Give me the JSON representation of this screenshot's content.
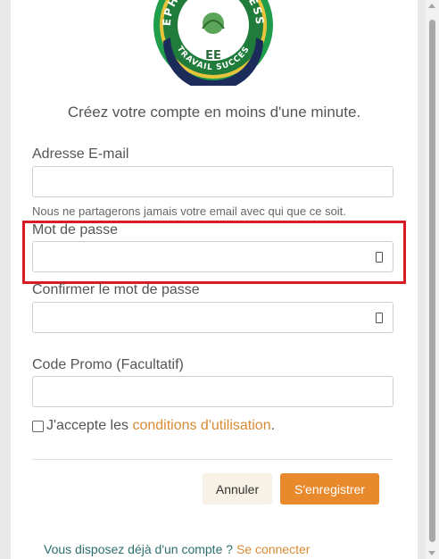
{
  "logo": {
    "arc_top": "EPHATA BUSINESS",
    "initials": "EE",
    "arc_bottom": "TRAVAIL SUCCES"
  },
  "subtitle": "Créez votre compte en moins d'une minute.",
  "email": {
    "label": "Adresse E-mail",
    "value": "",
    "help": "Nous ne partagerons jamais votre email avec qui que ce soit."
  },
  "password": {
    "label": "Mot de passe",
    "value": "",
    "toggle_icon": "eye-icon"
  },
  "confirm_password": {
    "label": "Confirmer le mot de passe",
    "value": "",
    "toggle_icon": "eye-icon"
  },
  "promo": {
    "label": "Code Promo (Facultatif)",
    "value": ""
  },
  "terms": {
    "checked": false,
    "prefix": "J'accepte les ",
    "link": "conditions d'utilisation",
    "suffix": "."
  },
  "buttons": {
    "cancel": "Annuler",
    "register": "S'enregistrer"
  },
  "login": {
    "prefix": "Vous disposez déjà d'un compte ? ",
    "link": "Se connecter"
  },
  "colors": {
    "accent": "#e8892c",
    "link": "#d98a33",
    "highlight": "#d81e24",
    "login_text": "#2c6e6e"
  }
}
